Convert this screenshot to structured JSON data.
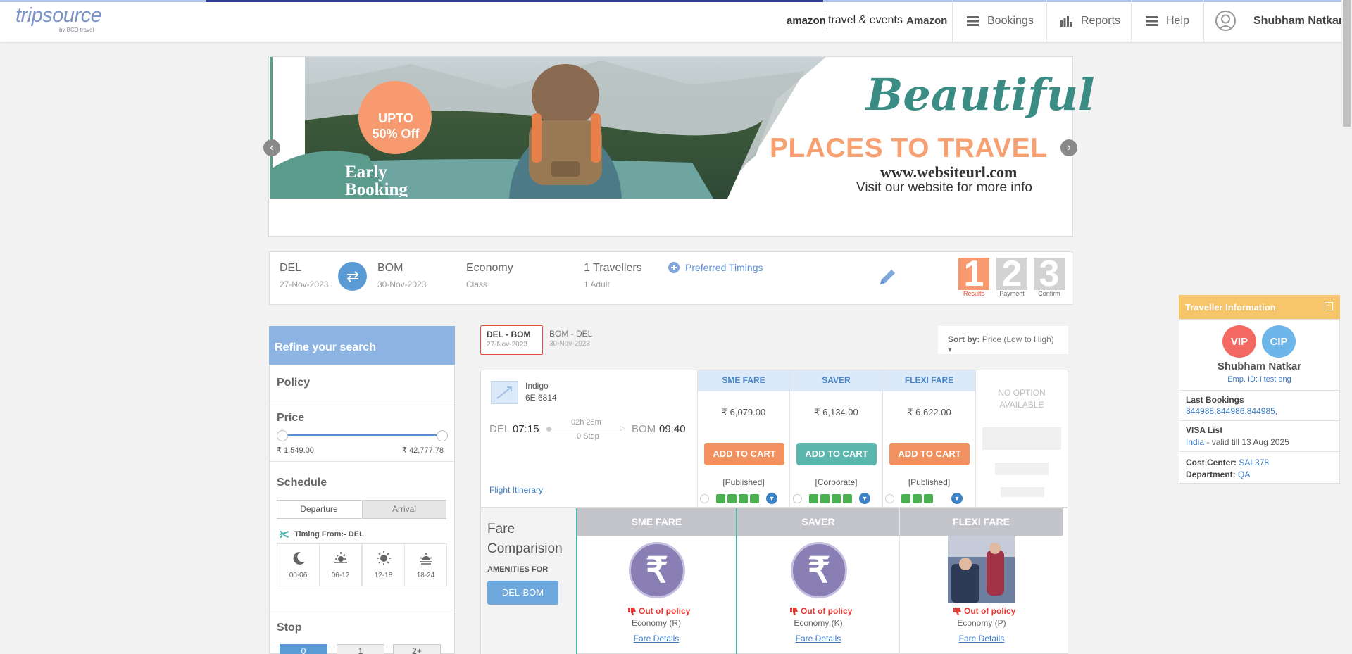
{
  "header": {
    "logo": "tripsource",
    "logo_sub": "by BCD travel",
    "company_logo": "amazon",
    "company_tagline": "travel & events",
    "company_name": "Amazon",
    "nav": [
      "Bookings",
      "Reports",
      "Help"
    ],
    "user_name": "Shubham Natkar"
  },
  "banner": {
    "headline_script": "Beautiful",
    "headline": "PLACES TO TRAVEL",
    "url": "www.websiteurl.com",
    "cta": "Visit our website for more info",
    "promo_line1": "UPTO",
    "promo_line2": "50% Off",
    "promo_early": "Early",
    "promo_booking": "Booking"
  },
  "search": {
    "from_code": "DEL",
    "from_date": "27-Nov-2023",
    "to_code": "BOM",
    "to_date": "30-Nov-2023",
    "cabin": "Economy",
    "cabin_label": "Class",
    "travellers": "1 Travellers",
    "travellers_sub": "1 Adult",
    "preferred_timings": "Preferred Timings",
    "steps": [
      {
        "num": "1",
        "label": "Results",
        "color": "#f79a6f"
      },
      {
        "num": "2",
        "label": "Payment",
        "color": "#d3d3d3"
      },
      {
        "num": "3",
        "label": "Confirm",
        "color": "#d3d3d3"
      }
    ]
  },
  "filters": {
    "heading": "Refine your search",
    "policy": "Policy",
    "price": "Price",
    "price_min": "₹ 1,549.00",
    "price_max": "₹ 42,777.78",
    "schedule": "Schedule",
    "departure": "Departure",
    "arrival": "Arrival",
    "timing_from": "Timing From:- DEL",
    "time_slots": [
      "00-06",
      "06-12",
      "12-18",
      "18-24"
    ],
    "stop": "Stop",
    "stop_options": [
      "0",
      "1",
      "2+"
    ]
  },
  "results": {
    "tabs": [
      {
        "route": "DEL  -  BOM",
        "date": "27-Nov-2023"
      },
      {
        "route": "BOM  -  DEL",
        "date": "30-Nov-2023"
      }
    ],
    "sort_label": "Sort by:",
    "sort_value": "Price (Low to High)",
    "flight": {
      "airline": "Indigo",
      "flight_no": "6E  6814",
      "dep_code": "DEL",
      "dep_time": "07:15",
      "duration": "02h 25m",
      "stops": "0 Stop",
      "arr_code": "BOM",
      "arr_time": "09:40",
      "itinerary_link": "Flight Itinerary"
    },
    "fares": [
      {
        "name": "SME FARE",
        "price": "₹ 6,079.00",
        "button": "ADD TO CART",
        "type": "[Published]",
        "btn_color": "#f0915f"
      },
      {
        "name": "SAVER",
        "price": "₹ 6,134.00",
        "button": "ADD TO CART",
        "type": "[Corporate]",
        "btn_color": "#5bb7ad"
      },
      {
        "name": "FLEXI FARE",
        "price": "₹ 6,622.00",
        "button": "ADD TO CART",
        "type": "[Published]",
        "btn_color": "#f0915f"
      }
    ],
    "no_option": "NO OPTION AVAILABLE"
  },
  "comparison": {
    "title_line1": "Fare",
    "title_line2": "Comparision",
    "amenities_for": "AMENITIES FOR",
    "route_btn": "DEL-BOM",
    "columns": [
      {
        "name": "SME FARE",
        "policy": "Out of policy",
        "class": "Economy (R)",
        "link": "Fare Details"
      },
      {
        "name": "SAVER",
        "policy": "Out of policy",
        "class": "Economy (K)",
        "link": "Fare Details"
      },
      {
        "name": "FLEXI FARE",
        "policy": "Out of policy",
        "class": "Economy (P)",
        "link": "Fare Details"
      }
    ]
  },
  "traveller": {
    "heading": "Traveller Information",
    "badges": [
      "VIP",
      "CIP"
    ],
    "name": "Shubham Natkar",
    "emp_id": "Emp. ID: i test eng",
    "last_bookings_label": "Last Bookings",
    "last_bookings": "844988,844986,844985,",
    "visa_label": "VISA List",
    "visa_country": "India",
    "visa_validity": " - valid till 13 Aug 2025",
    "cost_center_label": "Cost Center:",
    "cost_center": "SAL378",
    "department_label": "Department:",
    "department": "QA"
  }
}
